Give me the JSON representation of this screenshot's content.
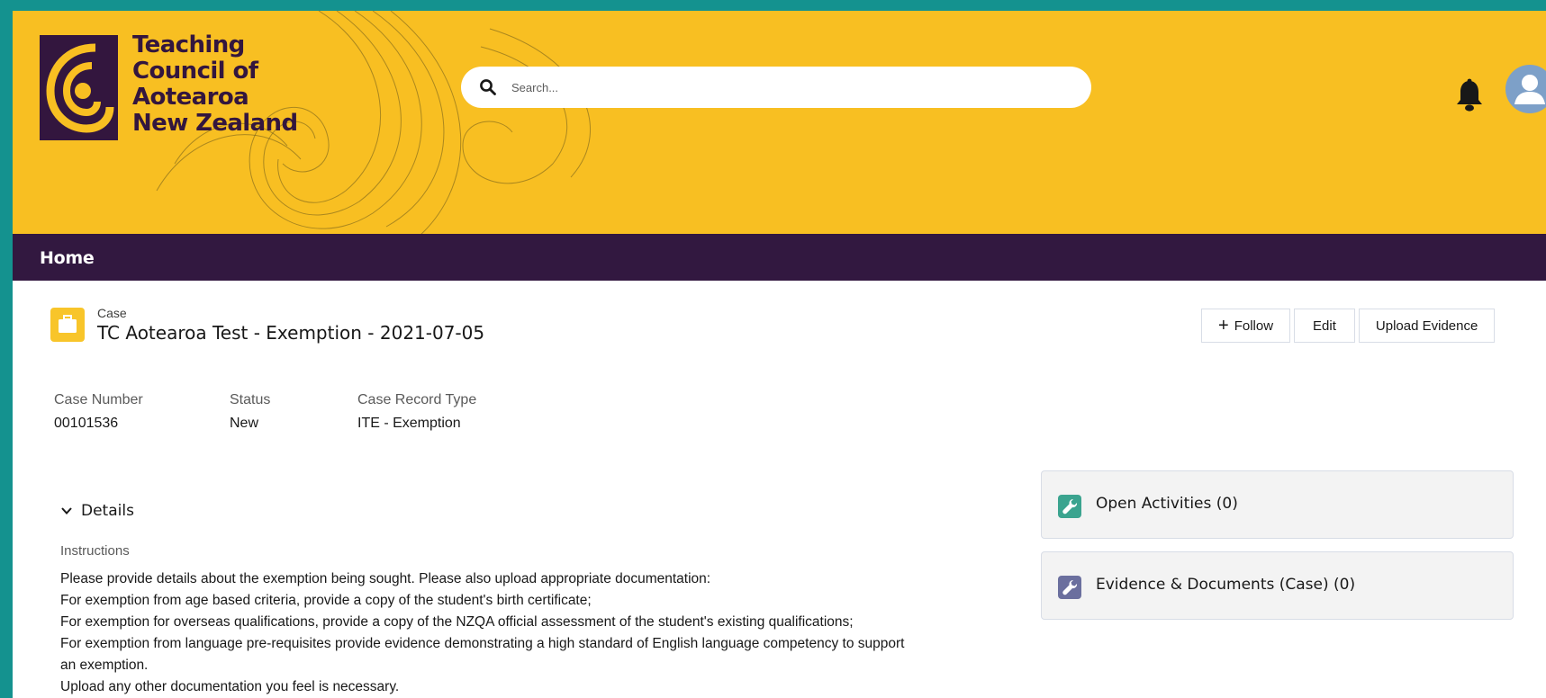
{
  "header": {
    "org_name_lines": [
      "Teaching",
      "Council of",
      "Aotearoa",
      "New Zealand"
    ],
    "search_placeholder": "Search..."
  },
  "nav": {
    "home_label": "Home"
  },
  "record": {
    "object_label": "Case",
    "title": "TC Aotearoa Test - Exemption - 2021-07-05",
    "actions": {
      "follow_label": "Follow",
      "edit_label": "Edit",
      "upload_label": "Upload Evidence"
    },
    "fields": [
      {
        "label": "Case Number",
        "value": "00101536"
      },
      {
        "label": "Status",
        "value": "New"
      },
      {
        "label": "Case Record Type",
        "value": "ITE - Exemption"
      }
    ]
  },
  "details": {
    "section_title": "Details",
    "instructions_label": "Instructions",
    "instructions_lines": [
      "Please provide details about the exemption being sought. Please also upload appropriate documentation:",
      "For exemption from age based criteria, provide a copy of the student's birth certificate;",
      "For exemption for overseas qualifications, provide a copy of the NZQA official assessment of the student's existing qualifications;",
      "For exemption from language pre-requisites provide evidence demonstrating a high standard of English language competency to support",
      "an exemption.",
      "Upload any other documentation you feel is necessary."
    ]
  },
  "related": [
    {
      "title": "Open Activities (0)",
      "icon": "wrench-icon",
      "color": "#3ba48f"
    },
    {
      "title": "Evidence & Documents (Case) (0)",
      "icon": "wrench-icon",
      "color": "#6b6f9e"
    }
  ],
  "colors": {
    "frame": "#14928f",
    "header_bg": "#f8bf22",
    "brand_purple": "#33163e",
    "nav_bg": "#321840",
    "case_icon": "#f8c52a",
    "avatar": "#7da0c8"
  }
}
